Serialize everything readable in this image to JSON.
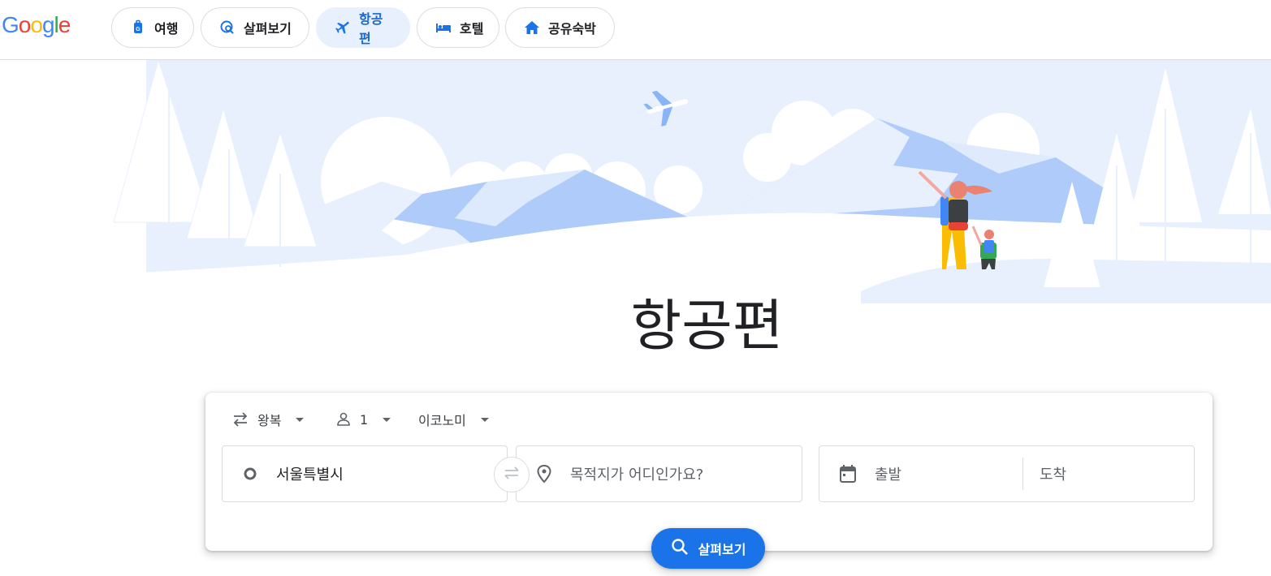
{
  "brand": {
    "logo_letters": [
      "G",
      "o",
      "o",
      "g",
      "l",
      "e"
    ],
    "logo_colors": [
      "#4285F4",
      "#EA4335",
      "#FBBC05",
      "#4285F4",
      "#34A853",
      "#EA4335"
    ]
  },
  "nav": {
    "tabs": [
      {
        "label": "여행",
        "icon": "suitcase-icon",
        "active": false
      },
      {
        "label": "살펴보기",
        "icon": "explore-icon",
        "active": false
      },
      {
        "label": "항공편",
        "icon": "plane-icon",
        "active": true
      },
      {
        "label": "호텔",
        "icon": "bed-icon",
        "active": false
      },
      {
        "label": "공유숙박",
        "icon": "home-icon",
        "active": false
      }
    ]
  },
  "hero": {
    "title": "항공편"
  },
  "search": {
    "trip_type": "왕복",
    "passengers": "1",
    "cabin_class": "이코노미",
    "origin_value": "서울특별시",
    "destination_placeholder": "목적지가 어디인가요?",
    "depart_placeholder": "출발",
    "return_placeholder": "도착",
    "explore_label": "살펴보기"
  },
  "colors": {
    "accent": "#1a73e8",
    "active_chip_bg": "#e8f0fe",
    "active_chip_text": "#1967d2",
    "illustration_light": "#e8f0fe",
    "illustration_mid": "#aecbfa"
  }
}
